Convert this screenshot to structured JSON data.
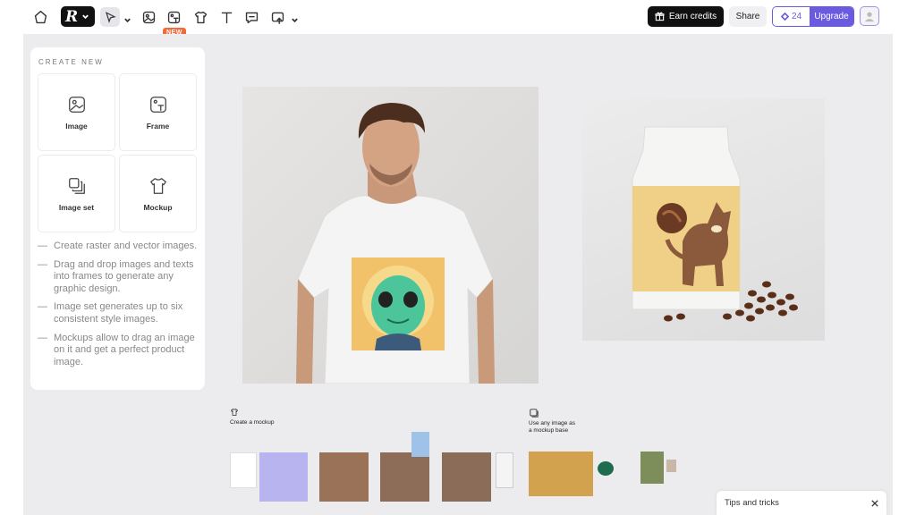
{
  "toolbar": {
    "new_badge": "NEW",
    "earn_credits": "Earn credits",
    "share": "Share",
    "credits": "24",
    "upgrade": "Upgrade"
  },
  "create_panel": {
    "title": "CREATE NEW",
    "cards": [
      {
        "label": "Image",
        "icon": "image-icon"
      },
      {
        "label": "Frame",
        "icon": "frame-icon"
      },
      {
        "label": "Image set",
        "icon": "image-set-icon"
      },
      {
        "label": "Mockup",
        "icon": "tshirt-icon"
      }
    ],
    "tips": [
      "Create raster and vector images.",
      "Drag and drop images and texts into frames to generate any graphic design.",
      "Image set generates up to six consistent style images.",
      "Mockups allow to drag an image on it and get a perfect product image."
    ]
  },
  "canvas_guides": {
    "mockup_title": "Create a mockup",
    "mockup_base_title": "Use any image as\na mockup base"
  },
  "tips_box": {
    "label": "Tips and tricks"
  },
  "colors": {
    "accent": "#6a5ae0",
    "badge": "#f06a3a",
    "canvas": "#ececef"
  }
}
